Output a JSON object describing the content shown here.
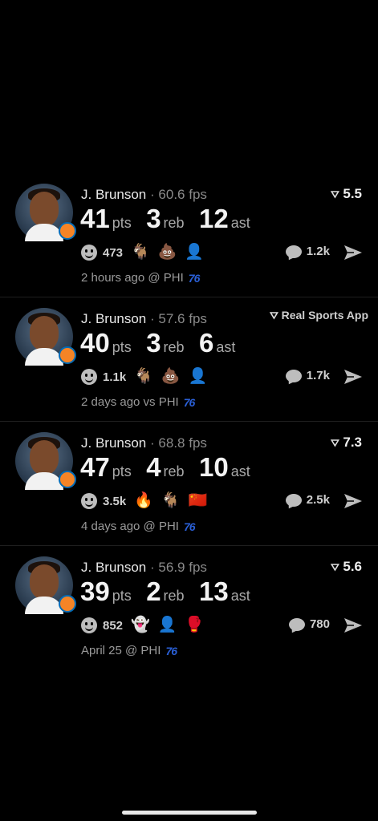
{
  "posts": [
    {
      "name": "J. Brunson",
      "fps": "60.6 fps",
      "rating": "5.5",
      "stats": {
        "pts": "41",
        "reb": "3",
        "ast": "12"
      },
      "reactions_count": "473",
      "reactions": [
        "🐐",
        "💩",
        "👤"
      ],
      "reaction_icons": [
        "goat-icon",
        "poop-icon",
        "player-face-icon"
      ],
      "comments": "1.2k",
      "time": "2 hours ago @ PHI"
    },
    {
      "name": "J. Brunson",
      "fps": "57.6 fps",
      "rating": "Real Sports App",
      "stats": {
        "pts": "40",
        "reb": "3",
        "ast": "6"
      },
      "reactions_count": "1.1k",
      "reactions": [
        "🐐",
        "💩",
        "👤"
      ],
      "reaction_icons": [
        "goat-icon",
        "poop-icon",
        "player-face-icon"
      ],
      "comments": "1.7k",
      "time": "2 days ago vs PHI"
    },
    {
      "name": "J. Brunson",
      "fps": "68.8 fps",
      "rating": "7.3",
      "stats": {
        "pts": "47",
        "reb": "4",
        "ast": "10"
      },
      "reactions_count": "3.5k",
      "reactions": [
        "🔥",
        "🐐",
        "🇨🇳"
      ],
      "reaction_icons": [
        "fire-icon",
        "goat-icon",
        "china-flag-icon"
      ],
      "comments": "2.5k",
      "time": "4 days ago @ PHI"
    },
    {
      "name": "J. Brunson",
      "fps": "56.9 fps",
      "rating": "5.6",
      "stats": {
        "pts": "39",
        "reb": "2",
        "ast": "13"
      },
      "reactions_count": "852",
      "reactions": [
        "👻",
        "👤",
        "🥊"
      ],
      "reaction_icons": [
        "ghost-icon",
        "player-face-icon",
        "boxing-gloves-icon"
      ],
      "comments": "780",
      "time": "April 25 @ PHI"
    }
  ],
  "labels": {
    "pts": "pts",
    "reb": "reb",
    "ast": "ast",
    "dot": "·",
    "sixers_num": "76"
  },
  "colors": {
    "background": "#000000",
    "sixers_red": "#e43a3a",
    "sixers_blue": "#2a5fd6",
    "knicks_orange": "#f58426"
  }
}
